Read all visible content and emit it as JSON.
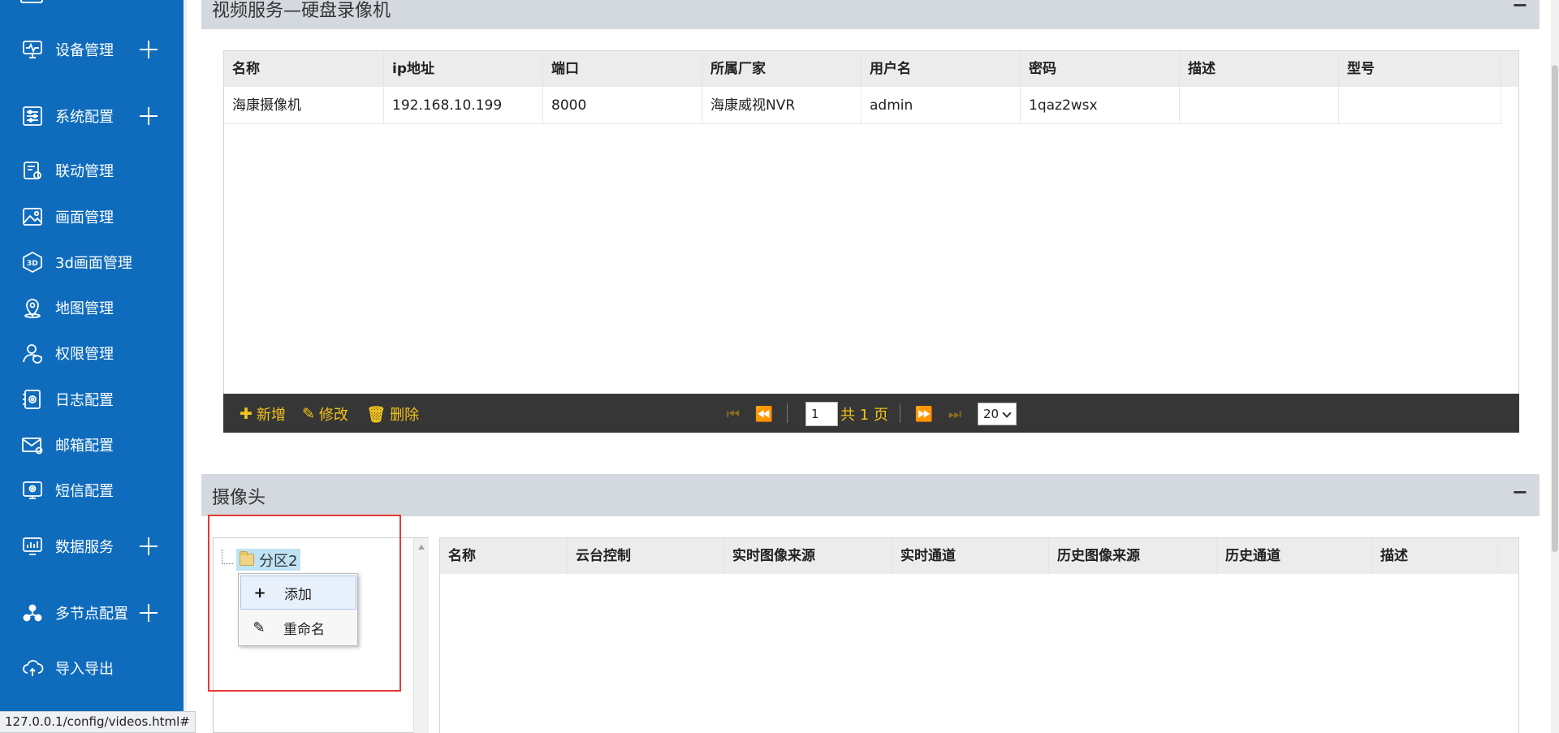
{
  "sidebar": {
    "items": [
      {
        "label": "设备管理",
        "icon": "monitor-pulse-icon",
        "expandable": true
      },
      {
        "label": "系统配置",
        "icon": "sliders-icon",
        "expandable": true
      },
      {
        "label": "联动管理",
        "icon": "linkage-icon",
        "expandable": false
      },
      {
        "label": "画面管理",
        "icon": "image-icon",
        "expandable": false
      },
      {
        "label": "3d画面管理",
        "icon": "3d-badge-icon",
        "expandable": false
      },
      {
        "label": "地图管理",
        "icon": "map-pin-icon",
        "expandable": false
      },
      {
        "label": "权限管理",
        "icon": "user-shield-icon",
        "expandable": false
      },
      {
        "label": "日志配置",
        "icon": "log-gear-icon",
        "expandable": false
      },
      {
        "label": "邮箱配置",
        "icon": "mail-gear-icon",
        "expandable": false
      },
      {
        "label": "短信配置",
        "icon": "sms-gear-icon",
        "expandable": false
      },
      {
        "label": "数据服务",
        "icon": "bar-chart-icon",
        "expandable": true
      },
      {
        "label": "多节点配置",
        "icon": "nodes-icon",
        "expandable": true
      },
      {
        "label": "导入导出",
        "icon": "cloud-sync-icon",
        "expandable": false
      }
    ]
  },
  "nvr_panel": {
    "title": "视频服务—硬盘录像机",
    "collapse": "−",
    "columns": [
      "名称",
      "ip地址",
      "端口",
      "所属厂家",
      "用户名",
      "密码",
      "描述",
      "型号"
    ],
    "rows": [
      [
        "海康摄像机",
        "192.168.10.199",
        "8000",
        "海康威视NVR",
        "admin",
        "1qaz2wsx",
        "",
        ""
      ]
    ]
  },
  "toolbar": {
    "add": "新增",
    "edit": "修改",
    "delete": "删除",
    "page": "1",
    "total": "共 1 页",
    "page_size": "20"
  },
  "camera_panel": {
    "title": "摄像头",
    "collapse": "−",
    "tree_node": "分区2",
    "context_menu": {
      "add": "添加",
      "rename": "重命名"
    },
    "columns": [
      "名称",
      "云台控制",
      "实时图像来源",
      "实时通道",
      "历史图像来源",
      "历史通道",
      "描述"
    ]
  },
  "status_url": "127.0.0.1/config/videos.html#"
}
